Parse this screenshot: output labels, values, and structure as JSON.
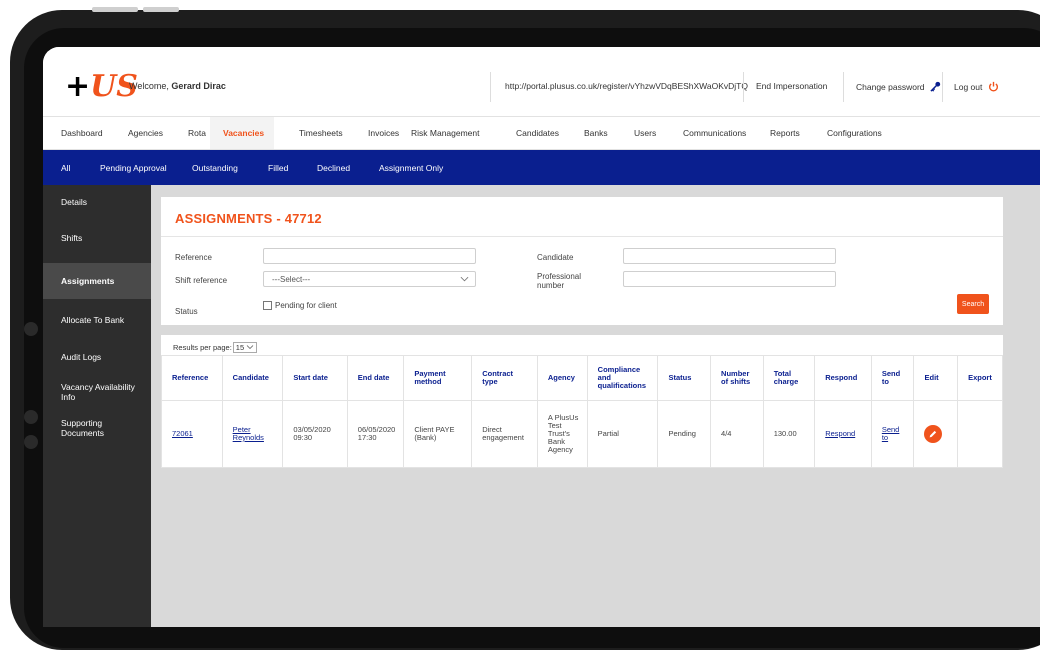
{
  "app": {
    "welcome_prefix": "Welcome,",
    "user_name": "Gerard Dirac",
    "url": "http://portal.plusus.co.uk/register/vYhzwVDqBEShXWaOKvDjTQ",
    "end_impersonation": "End Impersonation",
    "change_password": "Change password",
    "logout": "Log out",
    "accent_color": "#f0531c",
    "nav_color": "#0a1f8f"
  },
  "mainnav": [
    "Dashboard",
    "Agencies",
    "Rota",
    "Vacancies",
    "Timesheets",
    "Invoices",
    "Risk Management",
    "Candidates",
    "Banks",
    "Users",
    "Communications",
    "Reports",
    "Configurations"
  ],
  "subnav": [
    "All",
    "Pending Approval",
    "Outstanding",
    "Filled",
    "Declined",
    "Assignment Only"
  ],
  "sidebar": [
    "Details",
    "Shifts",
    "Assignments",
    "Allocate To Bank",
    "Audit Logs",
    "Vacancy Availability Info",
    "Supporting Documents"
  ],
  "filters": {
    "title": "ASSIGNMENTS - 47712",
    "reference_label": "Reference",
    "shift_reference_label": "Shift reference",
    "shift_reference_value": "---Select---",
    "status_label": "Status",
    "pending_label": "Pending for client",
    "candidate_label": "Candidate",
    "professional_number_label": "Professional number",
    "search_label": "Search"
  },
  "results": {
    "per_page_label": "Results per page:",
    "per_page_value": "15"
  },
  "table": {
    "headers": [
      "Reference",
      "Candidate",
      "Start date",
      "End date",
      "Payment method",
      "Contract type",
      "Agency",
      "Compliance and qualifications",
      "Status",
      "Number of shifts",
      "Total charge",
      "Respond",
      "Send to",
      "Edit",
      "Export"
    ],
    "rows": [
      {
        "reference": "72061",
        "candidate": "Peter Reynolds",
        "start_date": "03/05/2020 09:30",
        "end_date": "06/05/2020 17:30",
        "payment_method": "Client PAYE (Bank)",
        "contract_type": "Direct engagement",
        "agency": "A PlusUs Test Trust's Bank Agency",
        "compliance": "Partial",
        "status": "Pending",
        "shifts": "4/4",
        "total": "130.00",
        "respond": "Respond",
        "send_to": "Send to"
      }
    ]
  }
}
